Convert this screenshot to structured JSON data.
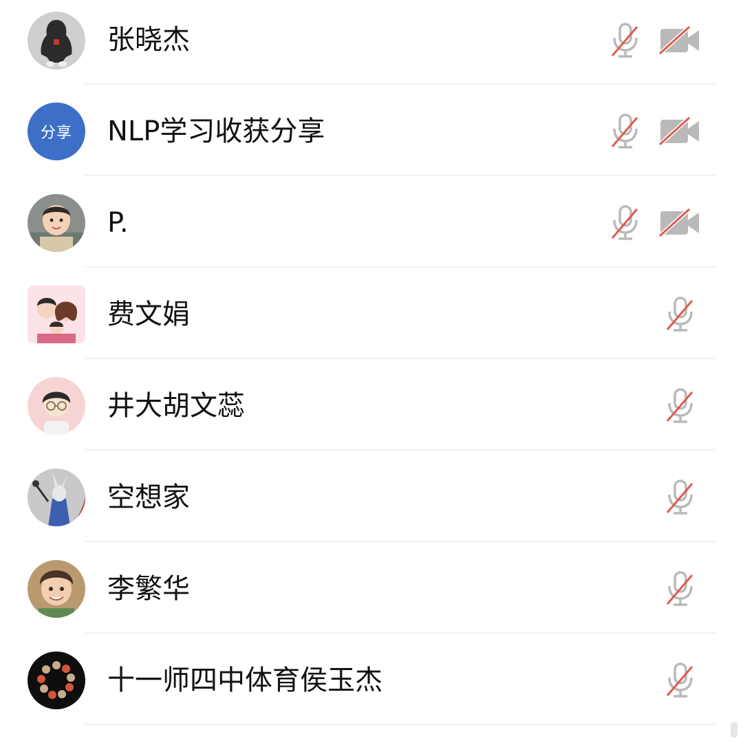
{
  "participants": [
    {
      "name": "张晓杰",
      "avatar": "person-in-hoodie-avatar",
      "mic": "mic-off-icon",
      "camera": "camera-off-icon"
    },
    {
      "name": "NLP学习收获分享",
      "avatar_text": "分享",
      "avatar_color": "#3d6fc6",
      "mic": "mic-off-icon",
      "camera": "camera-off-icon"
    },
    {
      "name": "P.",
      "avatar": "child-photo-avatar",
      "mic": "mic-off-icon",
      "camera": "camera-off-icon"
    },
    {
      "name": "费文娟",
      "avatar": "cartoon-family-avatar",
      "mic": "mic-off-icon"
    },
    {
      "name": "井大胡文蕊",
      "avatar": "cartoon-glasses-girl-avatar",
      "mic": "mic-off-icon"
    },
    {
      "name": "空想家",
      "avatar": "cartoon-rabbit-wizard-avatar",
      "mic": "mic-off-icon"
    },
    {
      "name": "李繁华",
      "avatar": "child-smiling-photo-avatar",
      "mic": "mic-off-icon"
    },
    {
      "name": "十一师四中体育侯玉杰",
      "avatar": "beads-bracelet-avatar",
      "mic": "mic-off-icon"
    }
  ],
  "colors": {
    "muted_slash": "#e05a4f",
    "icon_gray": "#b9b9b9",
    "divider": "#f1f1f1",
    "text": "#111111"
  }
}
